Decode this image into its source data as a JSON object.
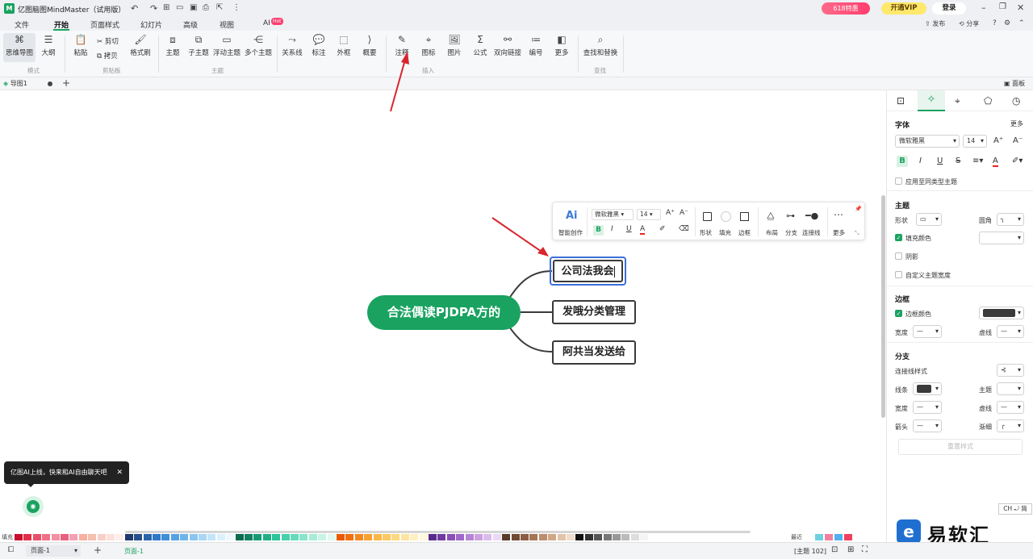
{
  "app": {
    "title": "亿图脑图MindMaster（试用版）",
    "promo_badge": "618特惠",
    "vip_button": "开通VIP",
    "login_button": "登录",
    "publish": "发布",
    "share": "分享"
  },
  "menu_tabs": [
    "文件",
    "开始",
    "页面样式",
    "幻灯片",
    "高级",
    "视图",
    "AI"
  ],
  "ai_badge": "Hot",
  "ribbon": {
    "mode": {
      "label": "模式",
      "items": [
        "思维导图",
        "大纲"
      ]
    },
    "clipboard": {
      "label": "剪贴板",
      "paste": "粘贴",
      "cut": "剪切",
      "copy": "拷贝",
      "format_painter": "格式刷"
    },
    "topic": {
      "label": "主题",
      "items": [
        "主题",
        "子主题",
        "浮动主题",
        "多个主题"
      ]
    },
    "insert": {
      "label": "插入",
      "items": [
        "关系线",
        "标注",
        "外框",
        "概要",
        "注释",
        "图标",
        "图片",
        "公式",
        "双向链接",
        "编号",
        "更多"
      ]
    },
    "find": {
      "label": "查找",
      "items": [
        "查找和替换"
      ]
    }
  },
  "doc_tab": {
    "name": "导图1"
  },
  "panel_toggle": "面板",
  "mindmap": {
    "central": "合法偶读PJDPA方的",
    "children": [
      "公司法我会",
      "发哦分类管理",
      "阿共当发送给"
    ]
  },
  "context_toolbar": {
    "ai_label": "Ai",
    "smart_create": "智能创作",
    "font": "微软雅黑",
    "size": "14",
    "buttons": [
      "形状",
      "填充",
      "边框",
      "布局",
      "分支",
      "连接线",
      "更多"
    ]
  },
  "right_panel": {
    "font_section": "字体",
    "more": "更多",
    "font_name": "微软雅黑",
    "font_size": "14",
    "apply_same": "应用至同类型主题",
    "topic_section": "主题",
    "shape": "形状",
    "corner": "圆角",
    "fill_color": "填充颜色",
    "shadow": "阴影",
    "custom_width": "自定义主题宽度",
    "border_section": "边框",
    "border_color": "边框颜色",
    "width": "宽度",
    "dash": "虚线",
    "branch_section": "分支",
    "connector_style": "连接线样式",
    "line": "线条",
    "topic": "主题",
    "width2": "宽度",
    "dash2": "虚线",
    "arrow": "箭头",
    "taper": "渐细",
    "reset": "重置样式"
  },
  "ai_tip": "亿图AI上线，快来和AI自由聊天吧",
  "palette": {
    "fill_label": "填充",
    "recent_label": "最近"
  },
  "status": {
    "page_select": "页面-1",
    "page_tab": "页面-1",
    "topic_count": "[主题 102]"
  },
  "ime": "CH ⤾ 简",
  "watermark": "易软汇",
  "colors": {
    "accent": "#1aa260",
    "node_border": "#3a3a3a",
    "selection": "#3b6fd8",
    "arrow": "#d8262f"
  }
}
